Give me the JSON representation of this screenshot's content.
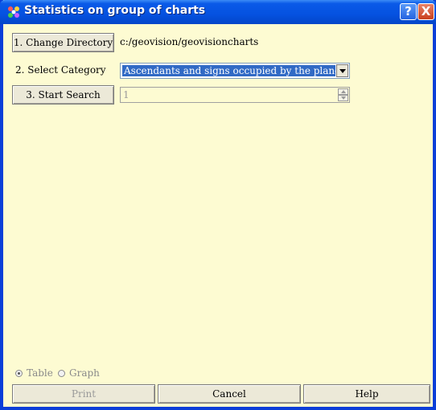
{
  "window": {
    "title": "Statistics on group of charts",
    "help_label": "?",
    "close_label": "X"
  },
  "step1": {
    "button_label": "1. Change Directory",
    "directory": "c:/geovision/geovisioncharts"
  },
  "step2": {
    "label": "2. Select Category",
    "selected_value": "Ascendants and signs occupied by the planets"
  },
  "step3": {
    "button_label": "3. Start Search",
    "spinner_value": "1"
  },
  "output_mode": {
    "options": [
      "Table",
      "Graph"
    ],
    "selected": "Table"
  },
  "footer": {
    "print_label": "Print",
    "cancel_label": "Cancel",
    "help_label": "Help"
  },
  "colors": {
    "title_bar": "#0552e0",
    "background": "#fdfbd2",
    "selection": "#316ac5",
    "close_button": "#c9401c"
  }
}
